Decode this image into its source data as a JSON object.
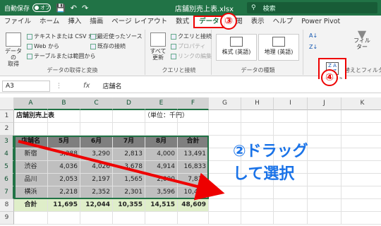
{
  "titlebar": {
    "autosave_label": "自動保存",
    "toggle_state": "オフ",
    "doc_title": "店舗別売上表.xlsx",
    "search_placeholder": "検索"
  },
  "menu": {
    "items": [
      "ファイル",
      "ホーム",
      "挿入",
      "描画",
      "ページ レイアウト",
      "数式",
      "データ",
      "校閲",
      "表示",
      "ヘルプ",
      "Power Pivot"
    ],
    "active_index": 6
  },
  "ribbon": {
    "get_data_label": "データの\n取得",
    "text_csv": "テキストまたは CSV から",
    "from_web": "Web から",
    "from_table": "テーブルまたは範囲から",
    "recent_sources": "最近使ったソース",
    "existing_connections": "既存の接続",
    "group_get": "データの取得と変換",
    "refresh_all": "すべて\n更新",
    "queries_connections": "クエリと接続",
    "properties": "プロパティ",
    "edit_links": "リンクの編集",
    "group_queries": "クエリと接続",
    "stocks": "株式 (英語)",
    "geography": "地理 (英語)",
    "group_datatypes": "データの種類",
    "sort_label": "並べ替え",
    "filter_label": "フィルター",
    "group_sort": "並べ替えとフィルター"
  },
  "formulabar": {
    "name_box": "A3",
    "fx": "fx",
    "value": "店舗名"
  },
  "columns": [
    "A",
    "B",
    "C",
    "D",
    "E",
    "F",
    "G",
    "H",
    "I",
    "J",
    "K"
  ],
  "rows": [
    "1",
    "2",
    "3",
    "4",
    "5",
    "6",
    "7",
    "8",
    "9"
  ],
  "sheet": {
    "title": "店舗別売上表",
    "unit": "（単位：千円）",
    "headers": [
      "店舗名",
      "5月",
      "6月",
      "7月",
      "8月",
      "合計"
    ],
    "data": [
      [
        "新宿",
        "3,388",
        "3,290",
        "2,813",
        "4,000",
        "13,491"
      ],
      [
        "渋谷",
        "4,036",
        "4,026",
        "3,678",
        "4,914",
        "16,833"
      ],
      [
        "品川",
        "2,053",
        "2,197",
        "1,565",
        "2,000",
        "7,818"
      ],
      [
        "横浜",
        "2,218",
        "2,352",
        "2,301",
        "3,596",
        "10,467"
      ]
    ],
    "total": [
      "合計",
      "11,695",
      "12,044",
      "10,355",
      "14,515",
      "48,609"
    ]
  },
  "annotations": {
    "step2_line1": "②ドラッグ",
    "step2_line2": "して選択",
    "step3": "③",
    "step4": "④"
  },
  "colors": {
    "excel_green": "#217346",
    "annotation_red": "#e00000",
    "annotation_blue": "#1a73e8"
  }
}
